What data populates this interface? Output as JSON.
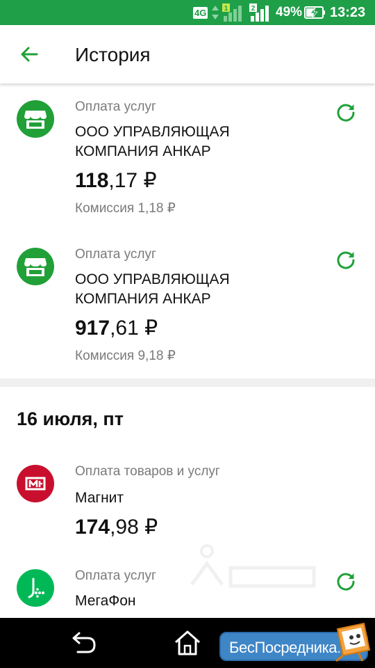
{
  "status_bar": {
    "network": "4G",
    "sim1": "1",
    "sim2": "2",
    "battery_percent": "49%",
    "time": "13:23"
  },
  "app_bar": {
    "back_icon": "arrow-left-icon",
    "title": "История"
  },
  "transactions": [
    {
      "category": "Оплата услуг",
      "merchant": "ООО УПРАВЛЯЮЩАЯ КОМПАНИЯ АНКАР",
      "amount_int": "118",
      "amount_frac": ",17 ₽",
      "commission": "Комиссия 1,18 ₽",
      "icon": "storefront-icon",
      "icon_color": "#21a038",
      "has_repeat": true
    },
    {
      "category": "Оплата услуг",
      "merchant": "ООО УПРАВЛЯЮЩАЯ КОМПАНИЯ АНКАР",
      "amount_int": "917",
      "amount_frac": ",61 ₽",
      "commission": "Комиссия 9,18 ₽",
      "icon": "storefront-icon",
      "icon_color": "#21a038",
      "has_repeat": true
    }
  ],
  "date_group": {
    "label": "16 июля, пт",
    "transactions": [
      {
        "category": "Оплата товаров и услуг",
        "merchant": "Магнит",
        "amount_int": "174",
        "amount_frac": ",98 ₽",
        "icon": "magnit-logo-icon",
        "icon_color": "#c8102e",
        "has_repeat": false
      },
      {
        "category": "Оплата услуг",
        "merchant": "МегаФон",
        "icon": "megafon-logo-icon",
        "icon_color": "#00b956",
        "has_repeat": true
      }
    ]
  },
  "nav_bar": {
    "back_icon": "android-back-icon",
    "home_icon": "android-home-icon"
  },
  "promo": {
    "text": "БесПосредника",
    "suffix": ".ru"
  },
  "colors": {
    "status_bar": "#1f9f48",
    "accent": "#21a038",
    "secondary_text": "#7a7a7a",
    "magnit": "#c8102e",
    "megafon": "#00b956"
  }
}
